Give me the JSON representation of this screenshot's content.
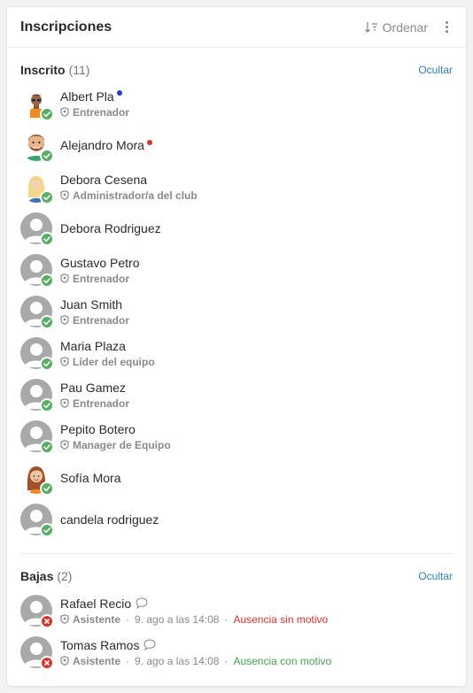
{
  "header": {
    "title": "Inscripciones",
    "sort_label": "Ordenar"
  },
  "colors": {
    "accent": "#2d7ebe",
    "ok": "#5aae64",
    "cancel": "#d9342b",
    "reason_red": "#d9342b",
    "reason_green": "#4aa052"
  },
  "registered": {
    "title": "Inscrito",
    "count": "(11)",
    "hide_label": "Ocultar",
    "members": [
      {
        "name": "Albert Pla",
        "role": "Entrenador",
        "avatar": "avatar-boy",
        "dot": "#1f3ec2"
      },
      {
        "name": "Alejandro Mora",
        "role": "",
        "avatar": "avatar-bearded-man",
        "dot": "#d9342b"
      },
      {
        "name": "Debora Cesena",
        "role": "Administrador/a del club",
        "avatar": "avatar-blonde-woman"
      },
      {
        "name": "Debora Rodriguez",
        "role": "",
        "avatar": "avatar-default"
      },
      {
        "name": "Gustavo Petro",
        "role": "Entrenador",
        "avatar": "avatar-default"
      },
      {
        "name": "Juan Smith",
        "role": "Entrenador",
        "avatar": "avatar-default"
      },
      {
        "name": "Maria Plaza",
        "role": "Líder del equipo",
        "avatar": "avatar-default"
      },
      {
        "name": "Pau Gamez",
        "role": "Entrenador",
        "avatar": "avatar-default"
      },
      {
        "name": "Pepito Botero",
        "role": "Manager de Equipo",
        "avatar": "avatar-default"
      },
      {
        "name": "Sofía Mora",
        "role": "",
        "avatar": "avatar-redhead-woman"
      },
      {
        "name": "candela rodriguez",
        "role": "",
        "avatar": "avatar-default"
      }
    ]
  },
  "cancelled": {
    "title": "Bajas",
    "count": "(2)",
    "hide_label": "Ocultar",
    "members": [
      {
        "name": "Rafael Recio",
        "role": "Asistente",
        "date": "9. ago a las 14:08",
        "reason": "Ausencia sin motivo",
        "reason_color": "#d9342b",
        "avatar": "avatar-default"
      },
      {
        "name": "Tomas Ramos",
        "role": "Asistente",
        "date": "9. ago a las 14:08",
        "reason": "Ausencia con motivo",
        "reason_color": "#4aa052",
        "avatar": "avatar-default"
      }
    ]
  }
}
